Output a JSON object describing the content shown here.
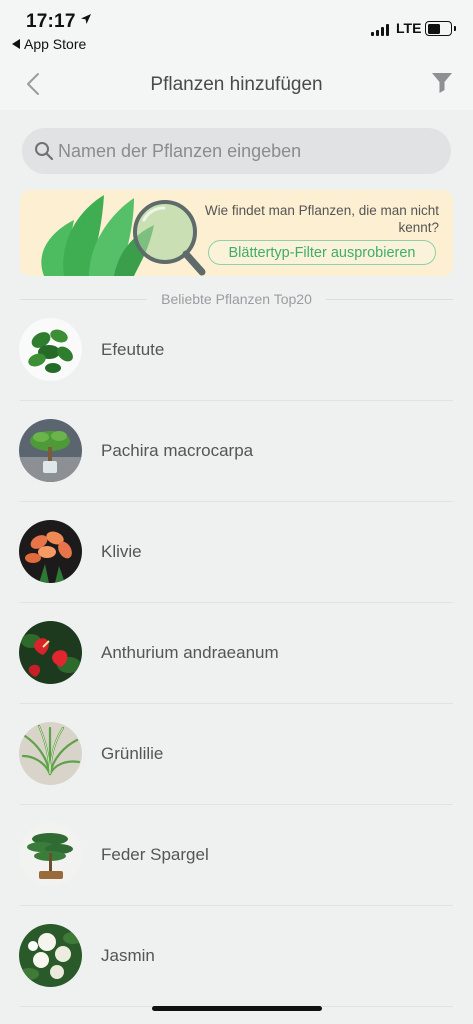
{
  "status_bar": {
    "time": "17:17",
    "back_app": "App Store",
    "network": "LTE",
    "battery_level": 0.55
  },
  "nav": {
    "title": "Pflanzen hinzufügen",
    "back_icon": "chevron-left-icon",
    "filter_icon": "funnel-icon"
  },
  "search": {
    "placeholder": "Namen der Pflanzen eingeben",
    "value": ""
  },
  "banner": {
    "text": "Wie findet man Pflanzen, die man nicht kennt?",
    "button_label": "Blättertyp-Filter ausprobieren",
    "accent_color": "#3fae6a",
    "background_color": "#fdf0d2"
  },
  "section": {
    "title": "Beliebte Pflanzen Top20"
  },
  "plants": [
    {
      "name": "Efeutute"
    },
    {
      "name": "Pachira macrocarpa"
    },
    {
      "name": "Klivie"
    },
    {
      "name": "Anthurium andraeanum"
    },
    {
      "name": "Grünlilie"
    },
    {
      "name": "Feder Spargel"
    },
    {
      "name": "Jasmin"
    }
  ]
}
